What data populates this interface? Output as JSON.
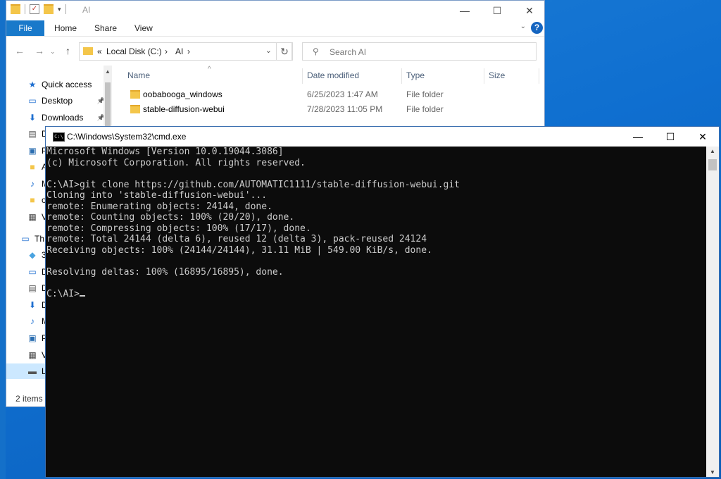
{
  "explorer": {
    "title": "AI",
    "ribbon": {
      "file": "File",
      "home": "Home",
      "share": "Share",
      "view": "View",
      "help": "?"
    },
    "address": {
      "prefix": "«",
      "drive": "Local Disk (C:)",
      "folder": "AI",
      "sep": "›"
    },
    "search_placeholder": "Search AI",
    "nav": [
      {
        "label": "Quick access",
        "icon": "star-icon",
        "pinned": false
      },
      {
        "label": "Desktop",
        "icon": "desktop-icon",
        "pinned": true
      },
      {
        "label": "Downloads",
        "icon": "download-icon",
        "pinned": true
      },
      {
        "label": "D",
        "icon": "document-icon"
      },
      {
        "label": "P",
        "icon": "picture-icon"
      },
      {
        "label": "A",
        "icon": "folder-icon"
      },
      {
        "label": "M",
        "icon": "music-icon"
      },
      {
        "label": "o",
        "icon": "folder-icon"
      },
      {
        "label": "V",
        "icon": "video-icon"
      },
      {
        "label": "Th",
        "icon": "computer-icon"
      },
      {
        "label": "3",
        "icon": "cube-icon"
      },
      {
        "label": "D",
        "icon": "desktop-icon"
      },
      {
        "label": "D",
        "icon": "document-icon"
      },
      {
        "label": "D",
        "icon": "download-icon"
      },
      {
        "label": "M",
        "icon": "music-icon"
      },
      {
        "label": "P",
        "icon": "picture-icon"
      },
      {
        "label": "V",
        "icon": "video-icon"
      },
      {
        "label": "L",
        "icon": "drive-icon"
      }
    ],
    "columns": {
      "name": "Name",
      "date": "Date modified",
      "type": "Type",
      "size": "Size"
    },
    "files": [
      {
        "name": "oobabooga_windows",
        "date": "6/25/2023 1:47 AM",
        "type": "File folder"
      },
      {
        "name": "stable-diffusion-webui",
        "date": "7/28/2023 11:05 PM",
        "type": "File folder"
      }
    ],
    "status": "2 items"
  },
  "cmd": {
    "title": "C:\\Windows\\System32\\cmd.exe",
    "lines": [
      "Microsoft Windows [Version 10.0.19044.3086]",
      "(c) Microsoft Corporation. All rights reserved.",
      "",
      "C:\\AI>git clone https://github.com/AUTOMATIC1111/stable-diffusion-webui.git",
      "Cloning into 'stable-diffusion-webui'...",
      "remote: Enumerating objects: 24144, done.",
      "remote: Counting objects: 100% (20/20), done.",
      "remote: Compressing objects: 100% (17/17), done.",
      "remote: Total 24144 (delta 6), reused 12 (delta 3), pack-reused 24124",
      "Receiving objects: 100% (24144/24144), 31.11 MiB | 549.00 KiB/s, done.",
      "",
      "Resolving deltas: 100% (16895/16895), done.",
      ""
    ],
    "prompt": "C:\\AI>"
  }
}
